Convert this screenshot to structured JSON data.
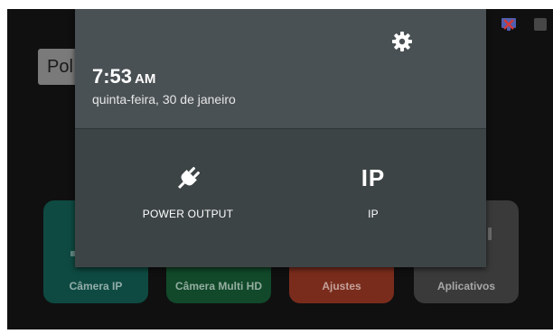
{
  "launcher": {
    "title_partial": "Pol",
    "tiles": [
      {
        "label": "Câmera IP",
        "color": "#0e4a41"
      },
      {
        "label": "Câmera Multi HD",
        "color": "#11492a"
      },
      {
        "label": "Ajustes",
        "color": "#7a2c1c"
      },
      {
        "label": "Aplicativos",
        "color": "#3a3a3a"
      }
    ]
  },
  "status_bar": {
    "icons": [
      "network-disconnected-icon",
      "battery-icon"
    ]
  },
  "quick_settings": {
    "time": "7:53",
    "ampm": "AM",
    "date": "quinta-feira, 30 de janeiro",
    "settings_icon": "gear-icon",
    "tiles": [
      {
        "icon": "plug-icon",
        "label": "POWER OUTPUT"
      },
      {
        "icon_text": "IP",
        "label": "IP"
      }
    ],
    "colors": {
      "panel_top": "#4a5154",
      "panel_bottom": "#3d4446"
    }
  }
}
